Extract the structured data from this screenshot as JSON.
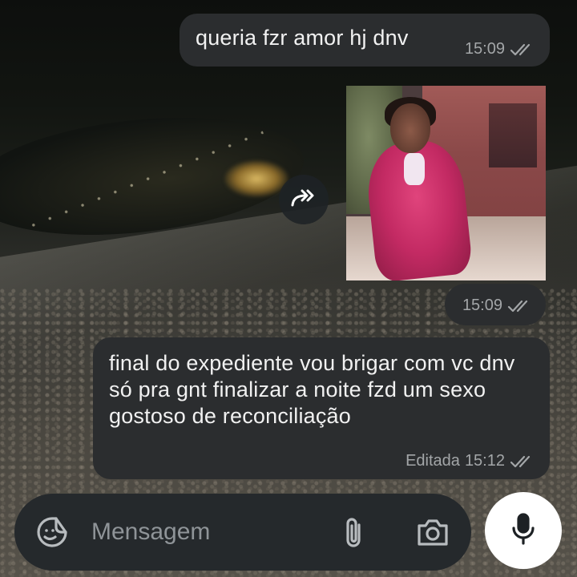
{
  "messages": [
    {
      "text": "queria fzr amor hj dnv",
      "time": "15:09",
      "status": "read-double-check"
    },
    {
      "type": "media-gif",
      "time": "15:09",
      "status": "read-double-check"
    },
    {
      "text": "final do expediente vou brigar com vc dnv só pra gnt finalizar a noite fzd um sexo gostoso de reconciliação",
      "edited_label": "Editada",
      "time": "15:12",
      "status": "read-double-check"
    }
  ],
  "composer": {
    "placeholder": "Mensagem",
    "icons": [
      "sticker-icon",
      "paperclip-icon",
      "camera-icon",
      "microphone-icon"
    ]
  },
  "colors": {
    "bubble": "#2b2d2f",
    "composer": "#25292c",
    "meta_text": "#a3a6a8",
    "mic_button": "#ffffff"
  }
}
